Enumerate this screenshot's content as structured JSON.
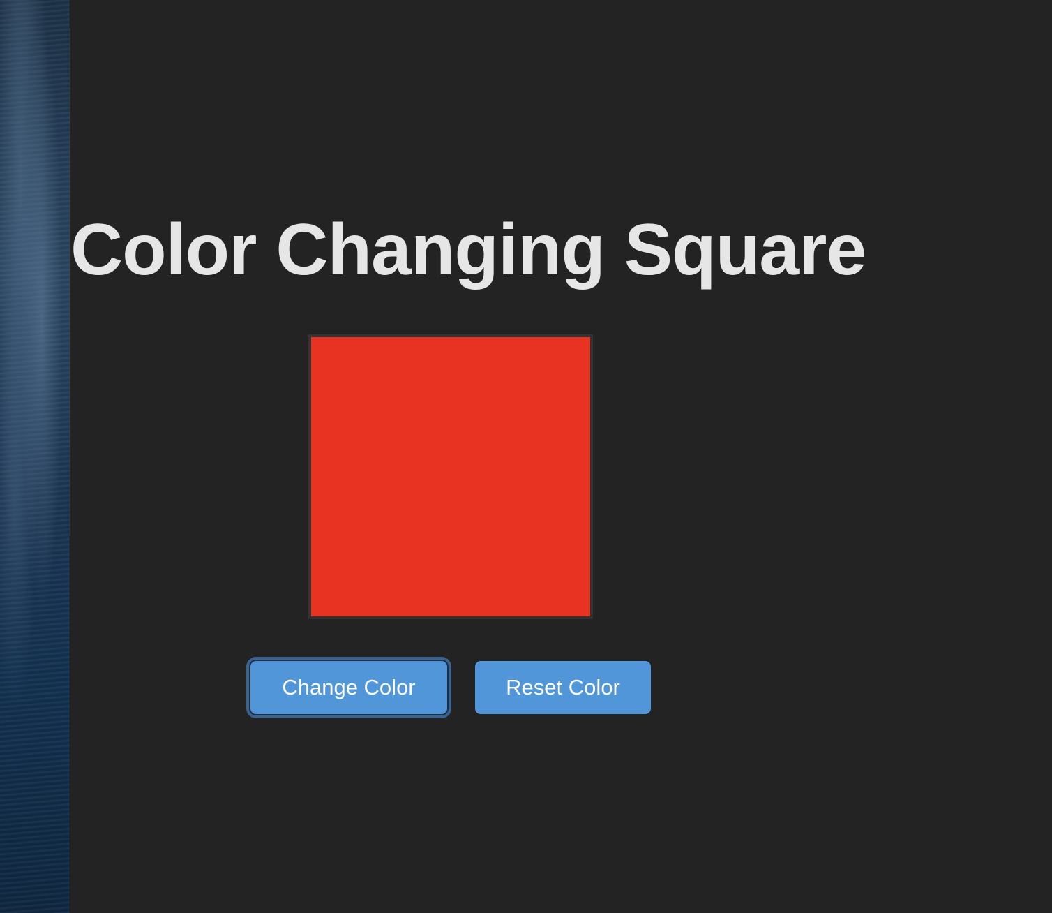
{
  "app": {
    "title": "Color Changing Square"
  },
  "square": {
    "color": "#e83323"
  },
  "buttons": {
    "change_label": "Change Color",
    "reset_label": "Reset Color"
  },
  "colors": {
    "background": "#232323",
    "title_text": "#e6e6e6",
    "button": "#5096d8",
    "button_text": "#ffffff"
  }
}
